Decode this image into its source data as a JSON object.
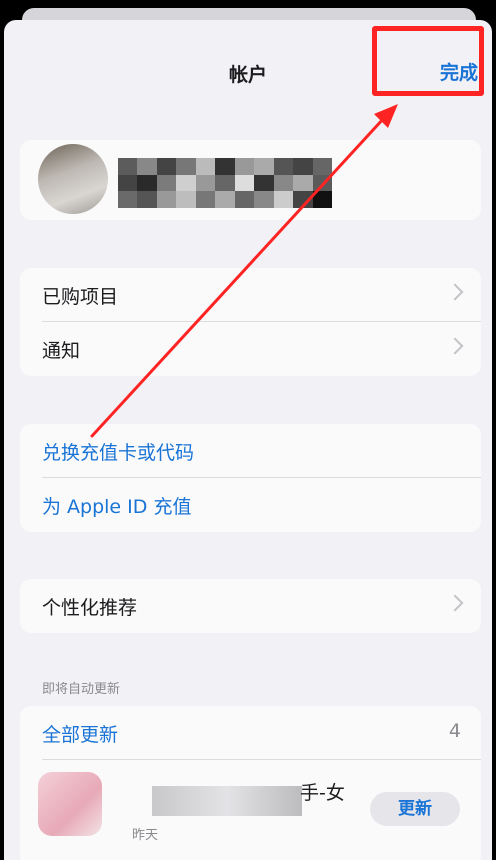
{
  "header": {
    "title": "帐户",
    "done_label": "完成"
  },
  "menu_main": [
    {
      "label": "已购项目"
    },
    {
      "label": "通知"
    }
  ],
  "menu_redeem": [
    {
      "label": "兑换充值卡或代码"
    },
    {
      "label": "为 Apple ID 充值"
    }
  ],
  "menu_personal": [
    {
      "label": "个性化推荐"
    }
  ],
  "updates": {
    "section_title": "即将自动更新",
    "update_all_label": "全部更新",
    "pending_count": "4",
    "app": {
      "name_suffix": "手-女",
      "date": "昨天",
      "button_label": "更新"
    }
  },
  "colors": {
    "accent": "#1a74d6",
    "annotation": "#ff2424",
    "background": "#f2f2f6"
  }
}
